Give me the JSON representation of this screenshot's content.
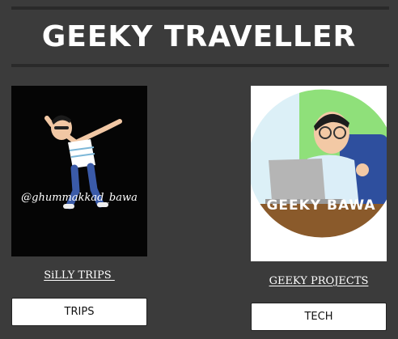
{
  "header": {
    "title": "GEEKY TRAVELLER"
  },
  "cards": [
    {
      "image_caption": "@ghummakkad_bawa",
      "link_label": "SiLLY TRIPS ",
      "button_label": "TRIPS"
    },
    {
      "image_caption": "GEEKY BAWA",
      "link_label": "GEEKY PROJECTS",
      "button_label": "TECH"
    }
  ],
  "colors": {
    "background": "#3b3b3b",
    "rule": "#2a2a2a",
    "text": "#ffffff",
    "button_bg": "#ffffff"
  }
}
